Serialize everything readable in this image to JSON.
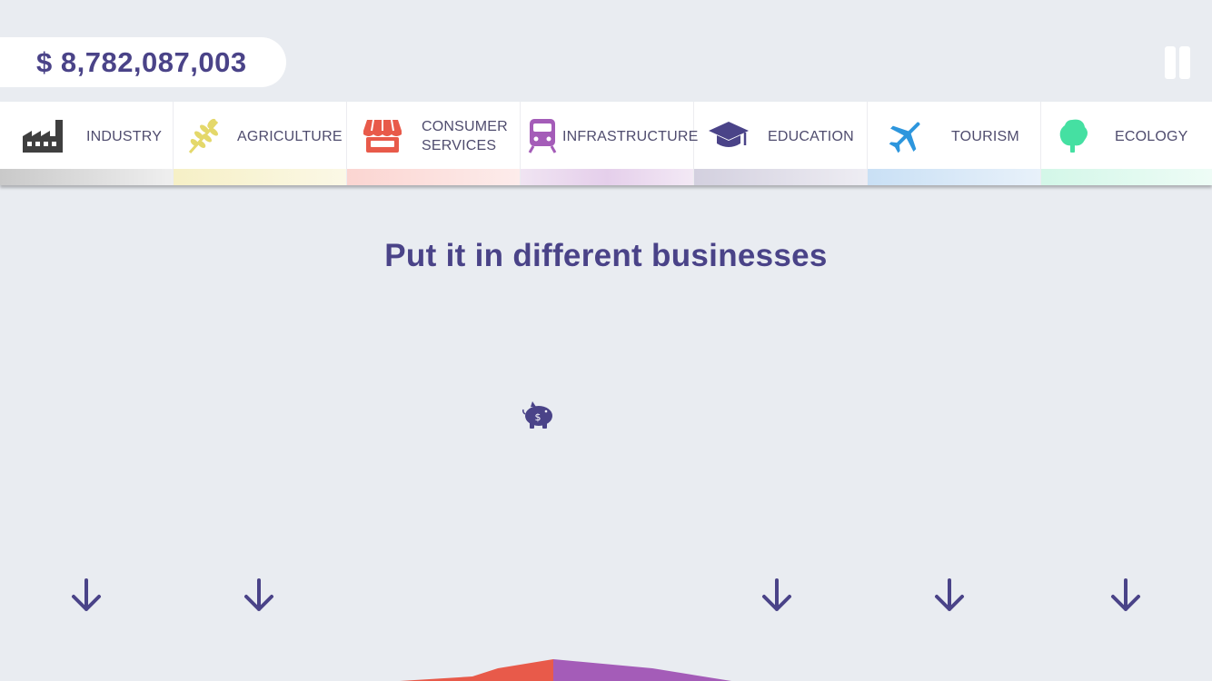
{
  "wallet": {
    "balance": "$ 8,782,087,003"
  },
  "pause": {
    "icon": "pause-icon"
  },
  "categories": [
    {
      "key": "industry",
      "label": "INDUSTRY",
      "icon": "factory-icon",
      "color": "#3f3f3f",
      "strip": "#c9c9c9"
    },
    {
      "key": "agriculture",
      "label": "AGRICULTURE",
      "icon": "wheat-icon",
      "color": "#e4d86a",
      "strip": "#f6f0c6"
    },
    {
      "key": "consumer",
      "label_line1": "CONSUMER",
      "label_line2": "SERVICES",
      "icon": "store-icon",
      "color": "#e85a4a",
      "strip": "#fbd5d1"
    },
    {
      "key": "infrastructure",
      "label": "INFRASTRUCTURE",
      "icon": "train-icon",
      "color": "#a45cb8",
      "strip": "#e9d6ee"
    },
    {
      "key": "education",
      "label": "EDUCATION",
      "icon": "graduation-cap-icon",
      "color": "#4a4388",
      "strip": "#d3d0df"
    },
    {
      "key": "tourism",
      "label": "TOURISM",
      "icon": "airplane-icon",
      "color": "#2d96dd",
      "strip": "#cfe4f7"
    },
    {
      "key": "ecology",
      "label": "ECOLOGY",
      "icon": "tree-icon",
      "color": "#45e0a2",
      "strip": "#d3f7e8"
    }
  ],
  "main": {
    "heading": "Put it in different businesses",
    "piggy_icon": "piggy-bank-icon"
  },
  "drop_targets": [
    "industry",
    "agriculture",
    "education",
    "tourism",
    "ecology"
  ],
  "colors": {
    "accent": "#4a4388",
    "background": "#e9ecf1",
    "hill_red": "#e85a4a",
    "hill_purple": "#a45cb8"
  }
}
